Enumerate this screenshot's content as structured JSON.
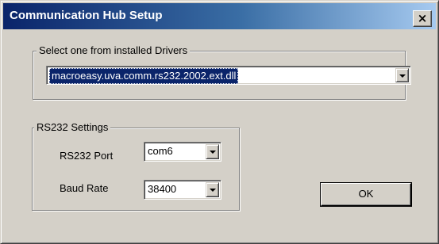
{
  "window": {
    "title": "Communication Hub Setup",
    "close_glyph": "×"
  },
  "drivers": {
    "group_label": "Select one from installed Drivers",
    "selected": "macroeasy.uva.comm.rs232.2002.ext.dll"
  },
  "rs232": {
    "group_label": "RS232 Settings",
    "port_label": "RS232 Port",
    "port_value": "com6",
    "baud_label": "Baud Rate",
    "baud_value": "38400"
  },
  "buttons": {
    "ok_label": "OK"
  },
  "colors": {
    "title_active": "#0a246a",
    "face": "#d4d0c8",
    "selection": "#0a246a"
  },
  "icons": {
    "close": "close-icon",
    "dropdown": "chevron-down-icon"
  }
}
